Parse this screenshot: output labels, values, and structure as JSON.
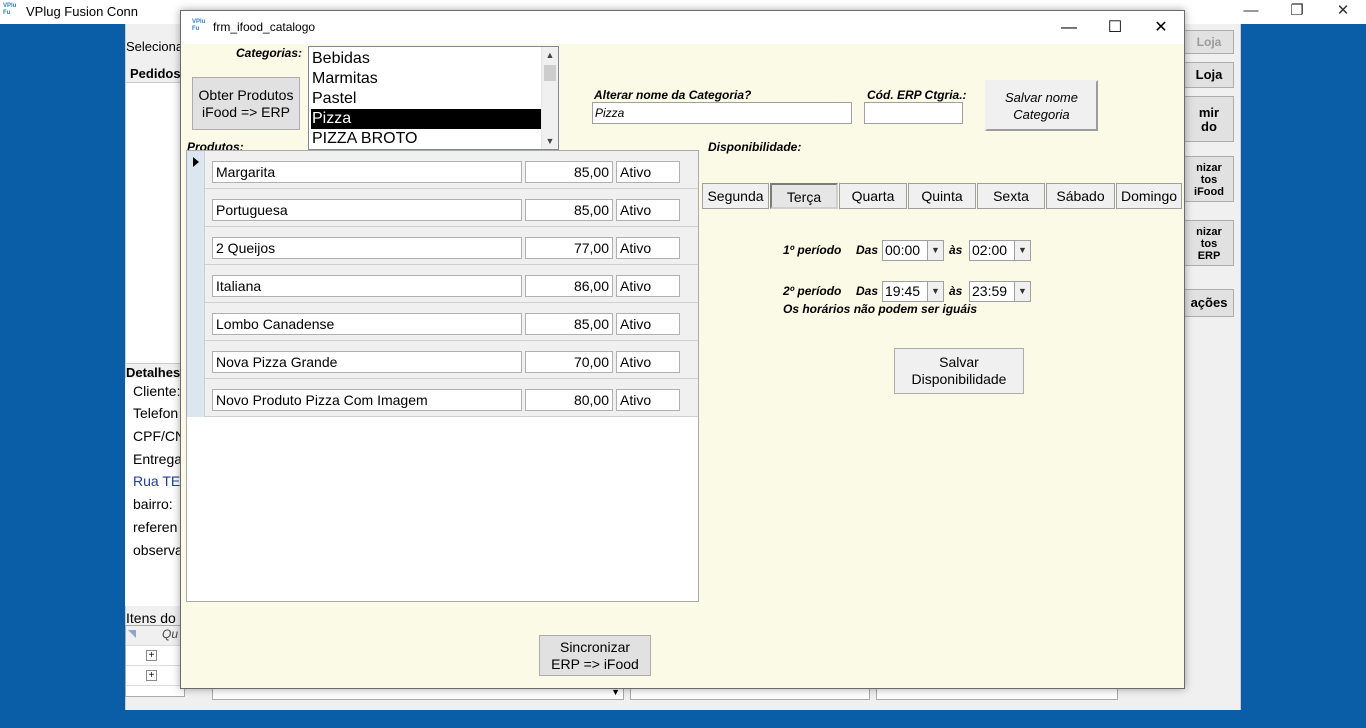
{
  "background_window": {
    "title": "VPlug Fusion Conn",
    "left_texts": {
      "selecione": "Seleciona",
      "pedidos": "Pedidos",
      "detalhes": "Detalhes",
      "cliente": "Cliente:",
      "telefone": "Telefon",
      "cpf": "CPF/CN",
      "entrega": "Entrega",
      "rua": "Rua TE",
      "bairro": "bairro:",
      "referencia": "referen",
      "observacao": "observa",
      "itens": "Itens do",
      "grid_header": "Qu"
    },
    "right_buttons": [
      "Loja",
      "Loja",
      "mir\ndo",
      "nizar\ntos\niFood",
      "nizar\ntos\nERP",
      "ações"
    ]
  },
  "dialog": {
    "title": "frm_ifood_catalogo",
    "categorias_label": "Categorias:",
    "obter_button": "Obter Produtos\niFood => ERP",
    "categories": [
      "Bebidas",
      "Marmitas",
      "Pastel",
      "Pizza",
      "PIZZA BROTO"
    ],
    "selected_category": "Pizza",
    "alterar_label": "Alterar nome da Categoria?",
    "category_name_value": "Pizza",
    "cod_erp_label": "Cód. ERP Ctgria.:",
    "cod_erp_value": "",
    "salvar_nome_button": "Salvar nome\nCategoria",
    "produtos_label": "Produtos:",
    "products": [
      {
        "name": "Margarita",
        "price": "85,00",
        "status": "Ativo"
      },
      {
        "name": "Portuguesa",
        "price": "85,00",
        "status": "Ativo"
      },
      {
        "name": "2 Queijos",
        "price": "77,00",
        "status": "Ativo"
      },
      {
        "name": "Italiana",
        "price": "86,00",
        "status": "Ativo"
      },
      {
        "name": "Lombo Canadense",
        "price": "85,00",
        "status": "Ativo"
      },
      {
        "name": "Nova Pizza Grande",
        "price": "70,00",
        "status": "Ativo"
      },
      {
        "name": "Novo Produto Pizza Com Imagem",
        "price": "80,00",
        "status": "Ativo"
      }
    ],
    "disponibilidade_label": "Disponibilidade:",
    "days": [
      "Segunda",
      "Terça",
      "Quarta",
      "Quinta",
      "Sexta",
      "Sábado",
      "Domingo"
    ],
    "selected_day": "Terça",
    "periodo1_label": "1º período",
    "periodo2_label": "2º período",
    "das_label": "Das",
    "as_label": "às",
    "p1_from": "00:00",
    "p1_to": "02:00",
    "p2_from": "19:45",
    "p2_to": "23:59",
    "warning": "Os horários não podem ser iguáis",
    "salvar_disp_button": "Salvar\nDisponibilidade",
    "sync_button": "Sincronizar\nERP => iFood"
  }
}
